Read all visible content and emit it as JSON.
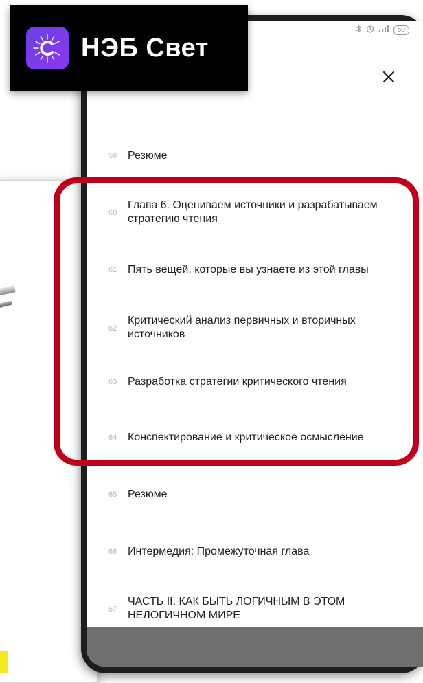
{
  "logo": {
    "text": "НЭБ Свет"
  },
  "status_bar": {
    "battery": "59"
  },
  "toc": {
    "items": [
      {
        "num": "59",
        "title": "Резюме"
      },
      {
        "num": "60",
        "title": "Глава 6. Оцениваем источники и разрабатываем стратегию чтения"
      },
      {
        "num": "61",
        "title": "Пять вещей, которые вы узнаете из этой главы"
      },
      {
        "num": "62",
        "title": "Критический анализ первичных и вторичных источников"
      },
      {
        "num": "63",
        "title": "Разработка стратегии критического чтения"
      },
      {
        "num": "64",
        "title": "Конспектирование и критическое осмысление"
      },
      {
        "num": "65",
        "title": "Резюме"
      },
      {
        "num": "66",
        "title": "Интермедия: Промежуточная глава"
      },
      {
        "num": "67",
        "title": "ЧАСТЬ II. КАК БЫТЬ ЛОГИЧНЫМ В ЭТОМ НЕЛОГИЧНОМ МИРЕ"
      }
    ]
  },
  "colors": {
    "highlight": "#c0001b",
    "logo_accent": "#7b3cf0"
  }
}
